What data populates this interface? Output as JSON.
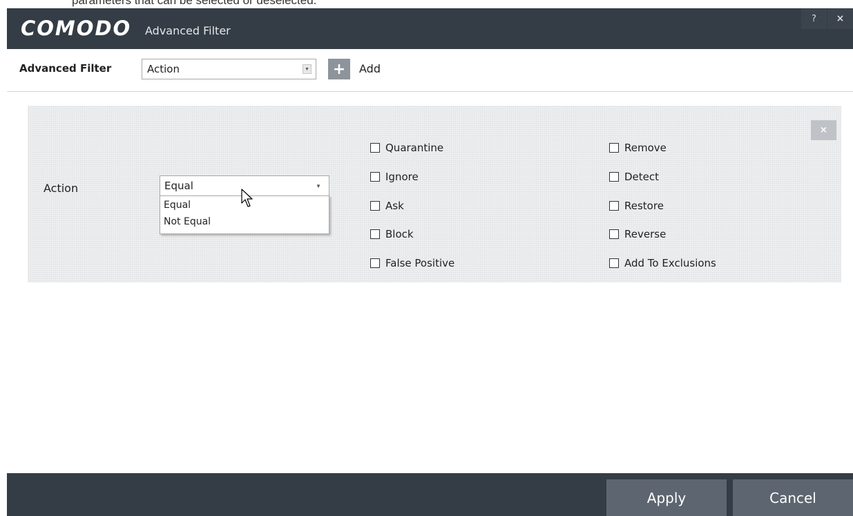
{
  "caption": "parameters that can be selected or deselected.",
  "window": {
    "brand": "COMODO",
    "title": "Advanced Filter",
    "help_glyph": "?",
    "close_glyph": "×"
  },
  "toolbar": {
    "label": "Advanced Filter",
    "selected_filter": "Action",
    "add_glyph": "+",
    "add_label": "Add"
  },
  "filter_row": {
    "close_glyph": "×",
    "field_label": "Action",
    "condition_value": "Equal",
    "condition_options": [
      "Equal",
      "Not Equal"
    ],
    "dropdown_open": true,
    "options_left": [
      {
        "label": "Quarantine",
        "checked": false
      },
      {
        "label": "Ignore",
        "checked": false
      },
      {
        "label": "Ask",
        "checked": false
      },
      {
        "label": "Block",
        "checked": false
      },
      {
        "label": "False Positive",
        "checked": false
      }
    ],
    "options_right": [
      {
        "label": "Remove",
        "checked": false
      },
      {
        "label": "Detect",
        "checked": false
      },
      {
        "label": "Restore",
        "checked": false
      },
      {
        "label": "Reverse",
        "checked": false
      },
      {
        "label": "Add To Exclusions",
        "checked": false
      }
    ]
  },
  "footer": {
    "apply_label": "Apply",
    "cancel_label": "Cancel"
  },
  "colors": {
    "titlebar": "#343d46",
    "footer_button": "#5d6670",
    "panel": "#ecedee"
  }
}
